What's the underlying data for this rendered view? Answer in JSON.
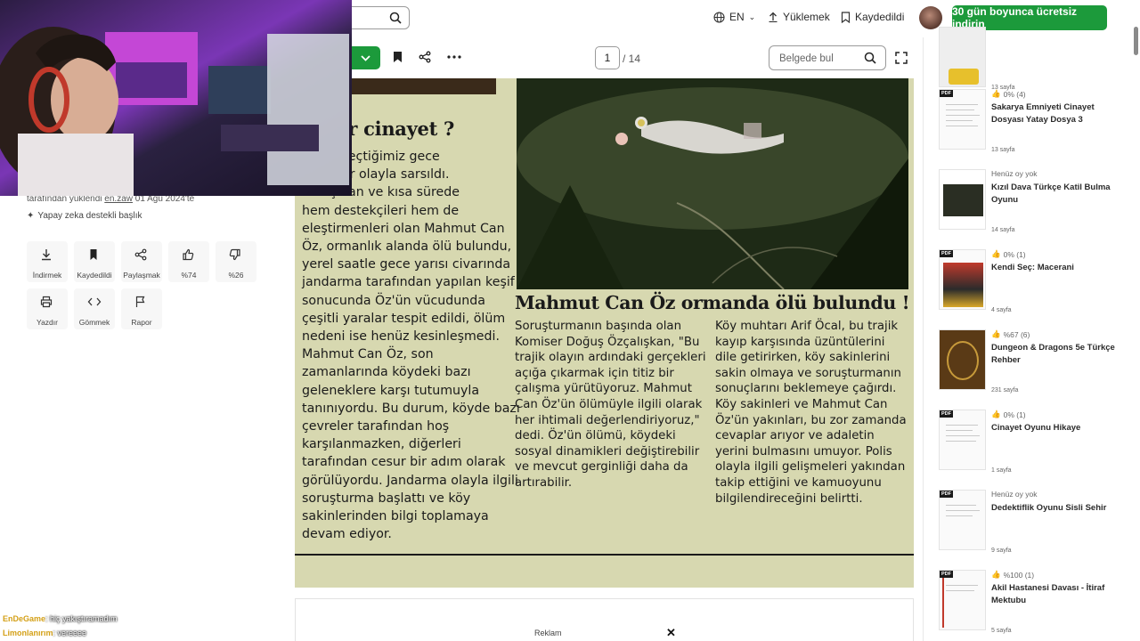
{
  "header": {
    "language": "EN",
    "upload_label": "Yüklemek",
    "saved_label": "Kaydedildi",
    "cta_label": "30 gün boyunca ücretsiz indirin"
  },
  "toolbar": {
    "current_page": "1",
    "total_pages": "/ 14",
    "find_placeholder": "Belgede bul"
  },
  "left_panel": {
    "uploaded_by": "tarafından yüklendi",
    "uploader": "en.zaw",
    "upload_date": "01 Ağu 2024'te",
    "ai_badge": "Yapay zeka destekli başlık",
    "actions": [
      {
        "label": "İndirmek",
        "icon": "download-icon"
      },
      {
        "label": "Kaydedildi",
        "icon": "bookmark-icon"
      },
      {
        "label": "Paylaşmak",
        "icon": "share-icon"
      },
      {
        "label": "%74",
        "icon": "thumbs-up-icon"
      },
      {
        "label": "%26",
        "icon": "thumbs-down-icon"
      },
      {
        "label": "Yazdır",
        "icon": "print-icon"
      },
      {
        "label": "Gömmek",
        "icon": "embed-icon"
      },
      {
        "label": "Rapor",
        "icon": "flag-icon"
      }
    ]
  },
  "chat": [
    {
      "user": "EnDeGame",
      "message": ": hiç yakıştıramadım"
    },
    {
      "user": "Limonlanırım",
      "message": ": vereeee"
    }
  ],
  "document": {
    "lead_headline": "nli bir cinayet ?",
    "lead_lines": [
      "köyü, geçtiğimiz gece",
      "trajik bir olayla sarsıldı.",
      "ni taşınan ve kısa sürede",
      "hem destekçileri hem de",
      "eleştirmenleri olan Mahmut Can",
      "Öz, ormanlık alanda ölü bulundu,",
      "yerel saatle gece yarısı civarında",
      "jandarma tarafından yapılan keşif",
      "sonucunda Öz'ün vücudunda",
      "çeşitli yaralar tespit edildi, ölüm",
      "nedeni ise henüz kesinleşmedi.",
      "Mahmut Can Öz, son",
      "zamanlarında köydeki bazı",
      "geleneklere karşı tutumuyla",
      "tanınıyordu. Bu durum, köyde bazı",
      "çevreler tarafından hoş",
      "karşılanmazken, diğerleri",
      "tarafından cesur bir adım olarak",
      "görülüyordu. Jandarma olayla ilgili",
      "soruşturma başlattı ve köy",
      "sakinlerinden bilgi toplamaya",
      "devam ediyor."
    ],
    "main_headline": "Mahmut Can Öz ormanda ölü bulundu !",
    "col1_lines": [
      "Soruşturmanın başında olan",
      "Komiser Doğuş Özçalışkan, \"Bu",
      "trajik olayın ardındaki gerçekleri",
      "açığa çıkarmak için titiz bir",
      "çalışma yürütüyoruz. Mahmut",
      "Can Öz'ün ölümüyle ilgili olarak",
      "her ihtimali değerlendiriyoruz,\"",
      "dedi. Öz'ün ölümü, köydeki",
      "sosyal dinamikleri değiştirebilir",
      "ve mevcut gerginliği daha da",
      "artırabilir."
    ],
    "col2_lines": [
      "Köy muhtarı Arif Öcal, bu trajik",
      "kayıp karşısında üzüntülerini",
      "dile getirirken, köy sakinlerini",
      "sakin olmaya ve soruşturmanın",
      "sonuçlarını beklemeye çağırdı.",
      "Köy sakinleri ve Mahmut Can",
      "Öz'ün yakınları, bu zor zamanda",
      "cevaplar arıyor ve adaletin",
      "yerini bulmasını umuyor. Polis",
      "olayla ilgili gelişmeleri yakından",
      "takip ettiğini ve kamuoyunu",
      "bilgilendireceğini belirtti."
    ]
  },
  "ad": {
    "label": "Reklam",
    "close": "✕"
  },
  "sidebar": {
    "pdf_badge": "PDF",
    "items": [
      {
        "rating": "",
        "title": "",
        "pages": "13 sayfa"
      },
      {
        "rating": "0% (4)",
        "title": "Sakarya Emniyeti Cinayet Dosyası Yatay Dosya 3",
        "pages": "13 sayfa"
      },
      {
        "rating": "Henüz oy yok",
        "title": "Kızıl Dava Türkçe Katil Bulma Oyunu",
        "pages": "14 sayfa"
      },
      {
        "rating": "0% (1)",
        "title": "Kendi Seç: Macerani",
        "pages": "4 sayfa"
      },
      {
        "rating": "%67 (6)",
        "title": "Dungeon & Dragons 5e Türkçe Rehber",
        "pages": "231 sayfa"
      },
      {
        "rating": "0% (1)",
        "title": "Cinayet Oyunu Hikaye",
        "pages": "1 sayfa"
      },
      {
        "rating": "Henüz oy yok",
        "title": "Dedektiflik Oyunu Sisli Sehir",
        "pages": "9 sayfa"
      },
      {
        "rating": "%100 (1)",
        "title": "Akil Hastanesi Davası - İtiraf Mektubu",
        "pages": "5 sayfa"
      }
    ]
  }
}
